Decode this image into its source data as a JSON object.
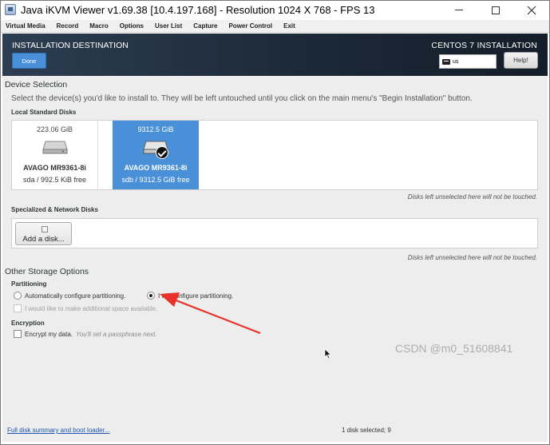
{
  "window": {
    "title": "Java iKVM Viewer v1.69.38 [10.4.197.168]  - Resolution 1024 X 768 - FPS 13"
  },
  "menubar": {
    "items": [
      "Virtual Media",
      "Record",
      "Macro",
      "Options",
      "User List",
      "Capture",
      "Power Control",
      "Exit"
    ]
  },
  "header": {
    "title": "INSTALLATION DESTINATION",
    "done_label": "Done",
    "product": "CENTOS 7 INSTALLATION",
    "keyboard_layout": "us",
    "help_label": "Help!"
  },
  "device_selection": {
    "heading": "Device Selection",
    "description": "Select the device(s) you'd like to install to.  They will be left untouched until you click on the main menu's \"Begin Installation\" button.",
    "local_heading": "Local Standard Disks",
    "disks": [
      {
        "size": "223.06 GiB",
        "name": "AVAGO MR9361-8i",
        "detail": "sda  /  992.5 KiB free",
        "selected": false
      },
      {
        "size": "9312.5 GiB",
        "name": "AVAGO MR9361-8i",
        "detail": "sdb  /  9312.5 GiB free",
        "selected": true
      }
    ],
    "local_note": "Disks left unselected here will not be touched.",
    "network_heading": "Specialized & Network Disks",
    "add_disk_label": "Add a disk...",
    "network_note": "Disks left unselected here will not be touched."
  },
  "storage_options": {
    "heading": "Other Storage Options",
    "partitioning_heading": "Partitioning",
    "auto_label": "Automatically configure partitioning.",
    "manual_label": "I will configure partitioning.",
    "selected": "manual",
    "extra_space_label": "I would like to make additional space available.",
    "encryption_heading": "Encryption",
    "encrypt_label": "Encrypt my data.",
    "encrypt_note": "You'll set a passphrase next."
  },
  "footer": {
    "summary_link": "Full disk summary and boot loader...",
    "status_text": "1 disk selected; 9",
    "status_link": "",
    "watermark": "CSDN @m0_51608841"
  },
  "colors": {
    "accent": "#4a90d9",
    "header_bg": "#1c2938",
    "annotation": "#e8312a"
  }
}
